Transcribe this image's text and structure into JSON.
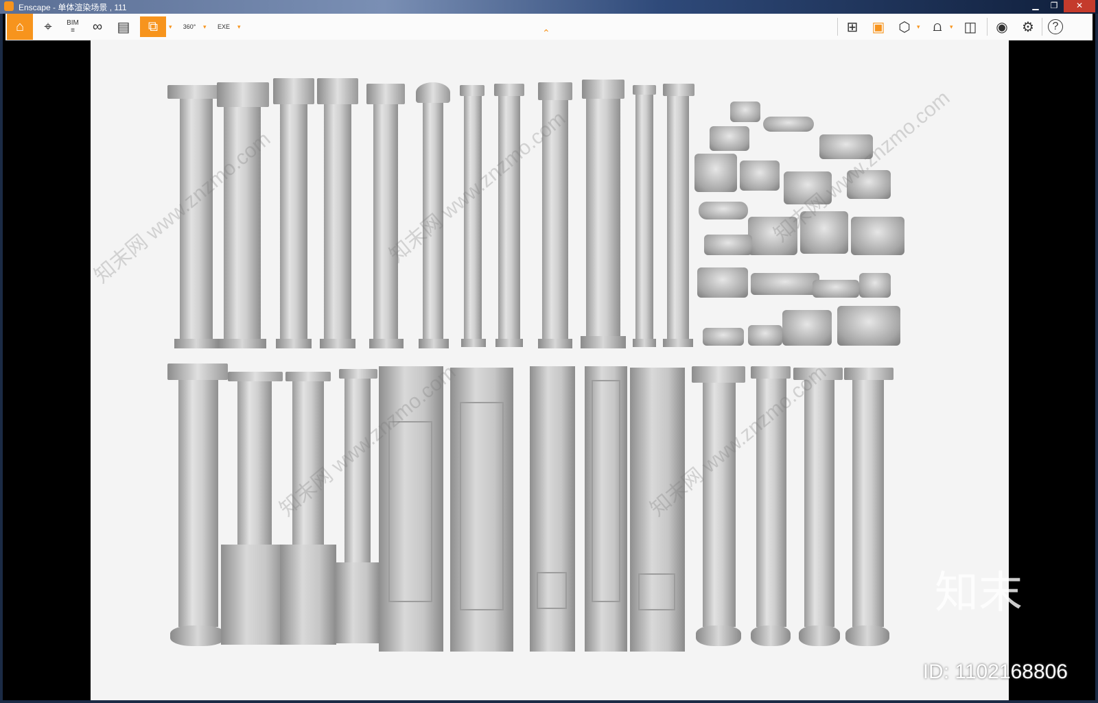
{
  "window": {
    "title": "Enscape - 单体渲染场景 , 111"
  },
  "toolbar": {
    "left_icons": [
      "home-icon",
      "location-icon",
      "bim-icon",
      "binoculars-icon",
      "clapper-icon",
      "render-export-icon",
      "panorama-360-icon",
      "exe-export-icon"
    ],
    "bim_label": "BIM",
    "pano_label": "360°",
    "exe_label": "EXE",
    "right_icons": [
      "map-icon",
      "asset-library-icon",
      "cube-icon",
      "arch-view-icon",
      "vr-headset-icon",
      "visibility-icon",
      "settings-icon",
      "help-icon"
    ],
    "help_label": "?"
  },
  "watermarks": {
    "site": "www.znzmo.com",
    "brand_cn": "知末网",
    "logo": "知末",
    "id": "ID: 1102168806"
  },
  "colors": {
    "accent": "#f7941d",
    "viewport_bg": "#f4f4f4"
  }
}
